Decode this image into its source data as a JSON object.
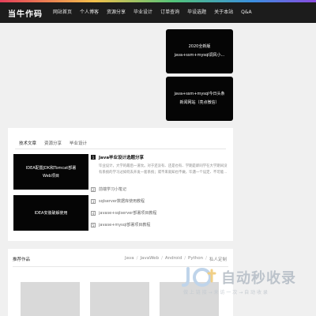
{
  "header": {
    "logo": "当牛作码",
    "nav": [
      "网站首页",
      "个人博客",
      "资源分享",
      "毕业设计",
      "订单查询",
      "毕设选题",
      "关于本站",
      "Q&A"
    ]
  },
  "side_cards": [
    {
      "line1": "2020全新版",
      "line2": "java+ssm+mysql调风小..."
    },
    {
      "line1": "java+ssm+mysql今日头条",
      "line2": "新闻网站（亮点微信）"
    }
  ],
  "panel": {
    "tabs": [
      "技术文章",
      "资源分享",
      "毕业设计"
    ],
    "features": [
      {
        "line1": "IDEA配置JDK和Tomcat部署",
        "line2": "Web项目"
      },
      {
        "line1": "IDEA安装破解使用",
        "line2": ""
      }
    ],
    "articles": [
      {
        "num": "1",
        "title": "Java毕业设计选题分享",
        "excerpt": "毕业设计，大学的最后一道坎。对于还没有、还是也有、学期是即同学在大学期间没有系统的学习过如何去开发一套系统；或不来就知也不做，毕遇一个设定、不可能..."
      },
      {
        "num": "2",
        "title": "前端学习小笔记"
      },
      {
        "num": "3",
        "title": "sqlserver数据库使用教程"
      },
      {
        "num": "4",
        "title": "javase+sqlserver部署项目教程"
      },
      {
        "num": "5",
        "title": "javase+mysql部署项目教程"
      }
    ]
  },
  "works": {
    "title": "推荐作品",
    "filters": [
      "Java",
      "JavaWeb",
      "Android",
      "Python",
      "私人定制"
    ]
  },
  "watermark": {
    "main": "自动秒收录",
    "sub": "做 上 链 接 → 来 访 一 次 → 自 动 收 录"
  }
}
